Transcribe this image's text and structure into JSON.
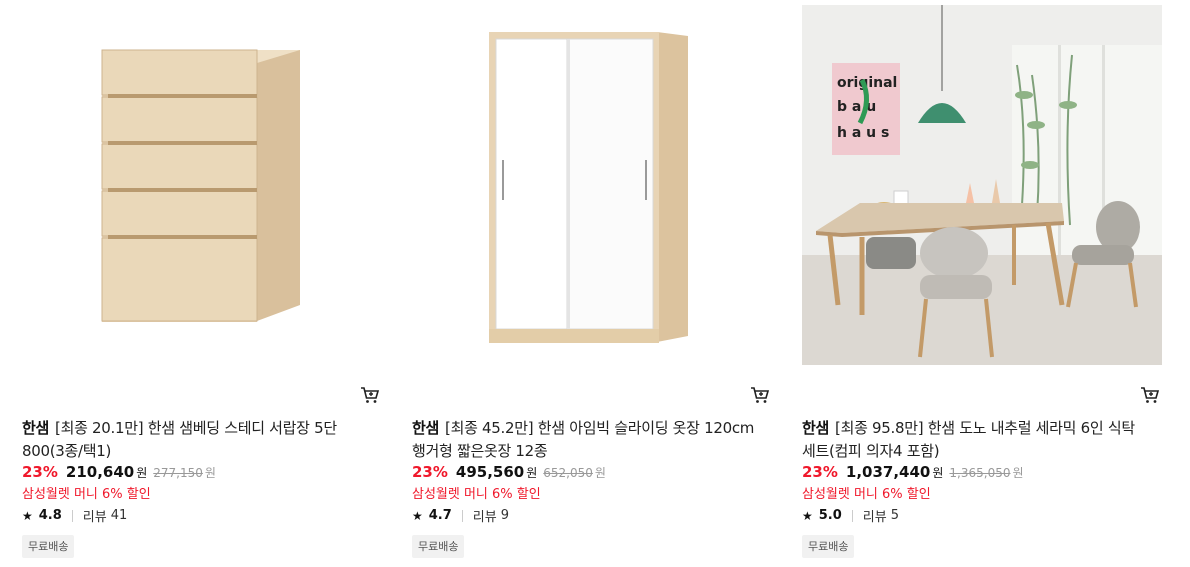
{
  "products": [
    {
      "brand": "한샘",
      "name": "[최종 20.1만] 한샘 샘베딩 스테디 서랍장 5단 800(3종/택1)",
      "discount": "23%",
      "price": "210,640",
      "currency": "원",
      "original_price": "277,150",
      "promo": "삼성월렛 머니 6% 할인",
      "rating": "4.8",
      "review_label": "리뷰",
      "review_count": "41",
      "badge": "무료배송",
      "image_icon": "drawer-chest-image"
    },
    {
      "brand": "한샘",
      "name": "[최종 45.2만] 한샘 아임빅 슬라이딩 옷장 120cm 행거형 짧은옷장 12종",
      "discount": "23%",
      "price": "495,560",
      "currency": "원",
      "original_price": "652,050",
      "promo": "삼성월렛 머니 6% 할인",
      "rating": "4.7",
      "review_label": "리뷰",
      "review_count": "9",
      "badge": "무료배송",
      "image_icon": "wardrobe-image"
    },
    {
      "brand": "한샘",
      "name": "[최종 95.8만] 한샘 도노 내추럴 세라믹 6인 식탁세트(컴피 의자4 포함)",
      "discount": "23%",
      "price": "1,037,440",
      "currency": "원",
      "original_price": "1,365,050",
      "promo": "삼성월렛 머니 6% 할인",
      "rating": "5.0",
      "review_label": "리뷰",
      "review_count": "5",
      "badge": "무료배송",
      "image_icon": "dining-set-image",
      "poster_text": [
        "original",
        "b a u",
        "h a u s"
      ]
    }
  ],
  "colors": {
    "discount_red": "#f0182b",
    "promo_red": "#f0182b",
    "badge_bg": "#f1f1f1",
    "wood": "#e8d4b5",
    "wardrobe_white": "#ffffff",
    "pendant_green": "#3f8f6f"
  }
}
